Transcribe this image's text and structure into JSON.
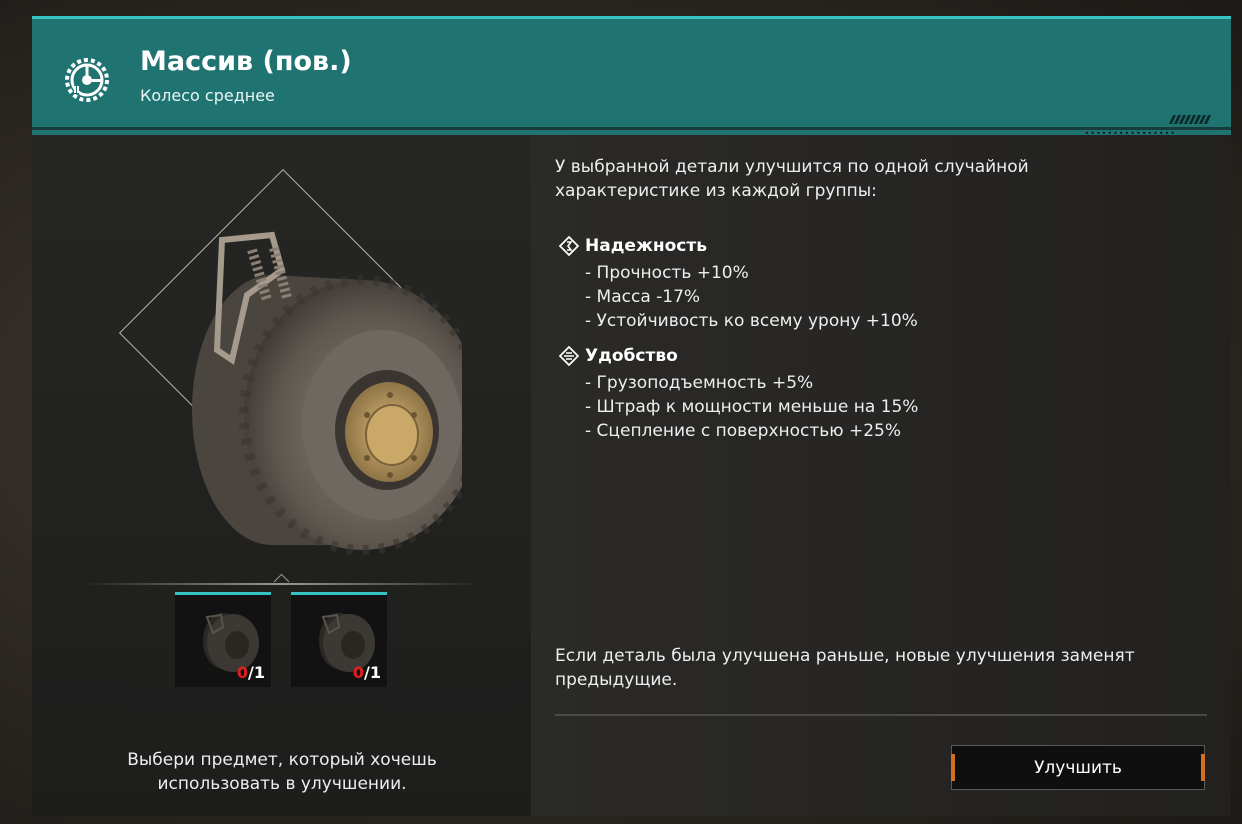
{
  "header": {
    "icon": "wheel-gear-icon",
    "title": "Массив (пов.)",
    "subtitle": "Колесо среднее",
    "accent_color": "#35c4c2",
    "bar_color": "#1f7472"
  },
  "left": {
    "preview": "wheel-image",
    "slots": [
      {
        "count_current": "0",
        "count_total": "/1"
      },
      {
        "count_current": "0",
        "count_total": "/1"
      }
    ],
    "hint": "Выбери предмет, который хочешь использовать в улучшении."
  },
  "right": {
    "intro": "У выбранной детали улучшится по одной случайной характеристике из каждой группы:",
    "groups": [
      {
        "icon": "reliability-diamond-icon",
        "title": "Надежность",
        "stats": [
          "- Прочность +10%",
          "- Масса -17%",
          "- Устойчивость ко всему урону +10%"
        ]
      },
      {
        "icon": "convenience-diamond-icon",
        "title": "Удобство",
        "stats": [
          "- Грузоподъемность +5%",
          "- Штраф к мощности меньше на 15%",
          "- Сцепление с поверхностью +25%"
        ]
      }
    ],
    "outro": "Если деталь была улучшена раньше, новые улучшения заменят предыдущие.",
    "upgrade_button": "Улучшить",
    "button_accent": "#d2701f"
  }
}
